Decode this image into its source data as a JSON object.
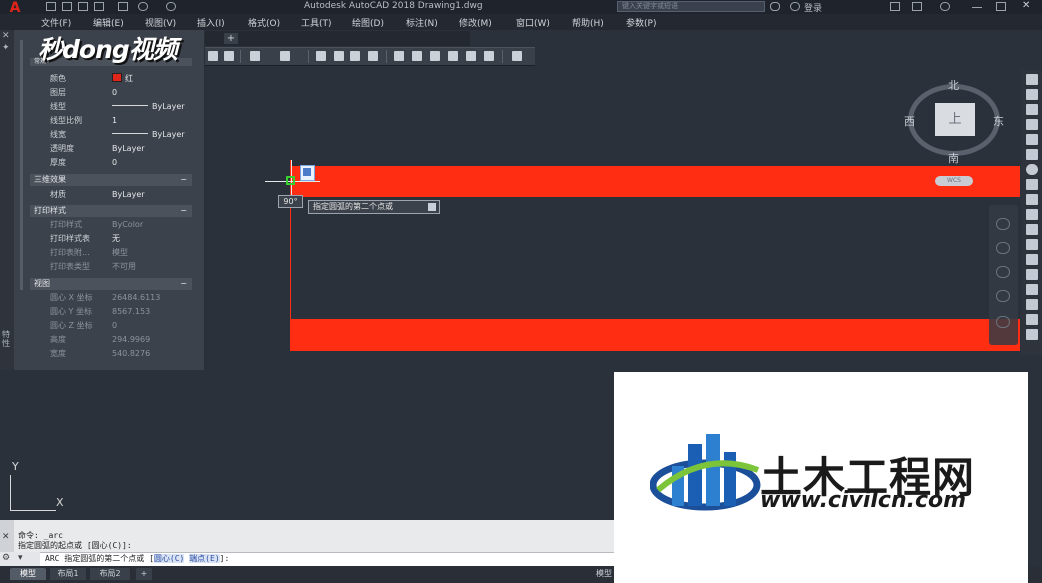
{
  "app": {
    "logo_letter": "A",
    "title": "Autodesk AutoCAD 2018    Drawing1.dwg",
    "search_placeholder": "键入关键字或短语",
    "login": "登录"
  },
  "menu": [
    "文件(F)",
    "编辑(E)",
    "视图(V)",
    "插入(I)",
    "格式(O)",
    "工具(T)",
    "绘图(D)",
    "标注(N)",
    "修改(M)",
    "窗口(W)",
    "帮助(H)",
    "参数(P)"
  ],
  "video_logo": "秒dong视频",
  "tab_add": "+",
  "properties": {
    "strip_label": "特性",
    "partial_top": "常规",
    "general": [
      {
        "key": "颜色",
        "value": "红",
        "swatch": "#e0261a"
      },
      {
        "key": "图层",
        "value": "0"
      },
      {
        "key": "线型",
        "value": "ByLayer",
        "linetype": true
      },
      {
        "key": "线型比例",
        "value": "1"
      },
      {
        "key": "线宽",
        "value": "ByLayer",
        "linetype": true
      },
      {
        "key": "透明度",
        "value": "ByLayer"
      },
      {
        "key": "厚度",
        "value": "0"
      }
    ],
    "section_3d": "三维效果",
    "three_d": [
      {
        "key": "材质",
        "value": "ByLayer"
      }
    ],
    "section_print": "打印样式",
    "print": [
      {
        "key": "打印样式",
        "value": "ByColor"
      },
      {
        "key": "打印样式表",
        "value": "无"
      },
      {
        "key": "打印表附...",
        "value": "模型"
      },
      {
        "key": "打印表类型",
        "value": "不可用"
      }
    ],
    "section_view": "视图",
    "view": [
      {
        "key": "圆心 X 坐标",
        "value": "26484.6113"
      },
      {
        "key": "圆心 Y 坐标",
        "value": "8567.153"
      },
      {
        "key": "圆心 Z 坐标",
        "value": "0"
      },
      {
        "key": "高度",
        "value": "294.9969"
      },
      {
        "key": "宽度",
        "value": "540.8276"
      }
    ],
    "collapse": "−"
  },
  "canvas": {
    "angle": "90°",
    "tooltip": "指定圆弧的第二个点或",
    "band_color": "#ff2d12",
    "viewcube": {
      "north": "北",
      "south": "南",
      "east": "东",
      "west": "西",
      "face": "上",
      "wcs": "WCS"
    },
    "ucs": {
      "x": "X",
      "y": "Y"
    }
  },
  "command": {
    "history_1": "命令: _arc",
    "history_2": "指定圆弧的起点或 [圆心(C)]:",
    "prompt_prefix": "ARC 指定圆弧的第二个点或 [",
    "opt1": "圆心(C)",
    "mid": " ",
    "opt2": "端点(E)",
    "suffix": "]:"
  },
  "layouts": {
    "model": "模型",
    "layout1": "布局1",
    "layout2": "布局2",
    "add": "+",
    "status_model": "模型"
  },
  "watermark": {
    "title": "土木工程网",
    "url": "www.civilcn.com"
  }
}
